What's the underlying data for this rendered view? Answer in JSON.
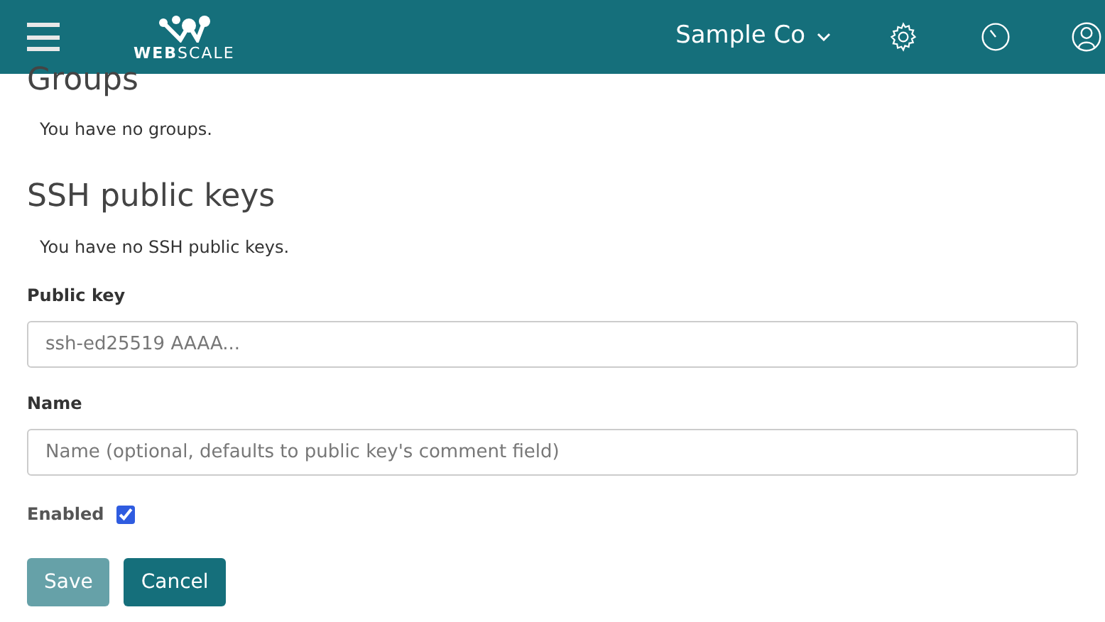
{
  "header": {
    "logo_text": "**WEB**SCALE",
    "company": "Sample Co"
  },
  "groups": {
    "title": "Groups",
    "empty_text": "You have no groups."
  },
  "ssh_keys": {
    "title": "SSH public keys",
    "empty_text": "You have no SSH public keys."
  },
  "form": {
    "fields": [
      {
        "label": "Public key",
        "placeholder": "ssh-ed25519 AAAA..."
      },
      {
        "label": "Name",
        "placeholder": "Name (optional, defaults to public key's comment field)"
      }
    ],
    "enabled": {
      "label": "Enabled",
      "checked": true
    },
    "buttons": [
      {
        "label": "Save",
        "disabled": true
      },
      {
        "label": "Cancel",
        "disabled": false
      }
    ]
  }
}
